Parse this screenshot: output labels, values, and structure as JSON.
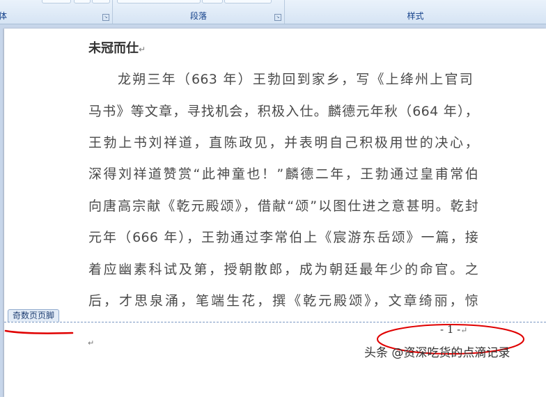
{
  "ribbon": {
    "groups": [
      {
        "label": "体"
      },
      {
        "label": "段落"
      },
      {
        "label": "样式"
      }
    ]
  },
  "document": {
    "heading": "未冠而仕",
    "paragraph_mark": "↵",
    "lines": [
      "龙朔三年（663 年）王勃回到家乡，写《上绛州上官司",
      "马书》等文章，寻找机会，积极入仕。麟德元年秋（664 年），",
      "王勃上书刘祥道，直陈政见，并表明自己积极用世的决心，",
      "深得刘祥道赞赏“此神童也！”麟德二年，王勃通过皇甫常伯",
      "向唐高宗献《乾元殿颂》，借献“颂”以图仕进之意甚明。乾封",
      "元年（666 年），王勃通过李常伯上《宸游东岳颂》一篇，接",
      "着应幽素科试及第，授朝散郎，成为朝廷最年少的命官。之",
      "后，才思泉涌，笔端生花，撰《乾元殿颂》，文章绮丽，惊"
    ]
  },
  "footer": {
    "tag": "奇数页页脚",
    "page_number": "- 1 -"
  },
  "watermark": "头条 @资深吃货的点滴记录",
  "colors": {
    "annotation_red": "#e00000",
    "ribbon_label": "#15428b"
  }
}
